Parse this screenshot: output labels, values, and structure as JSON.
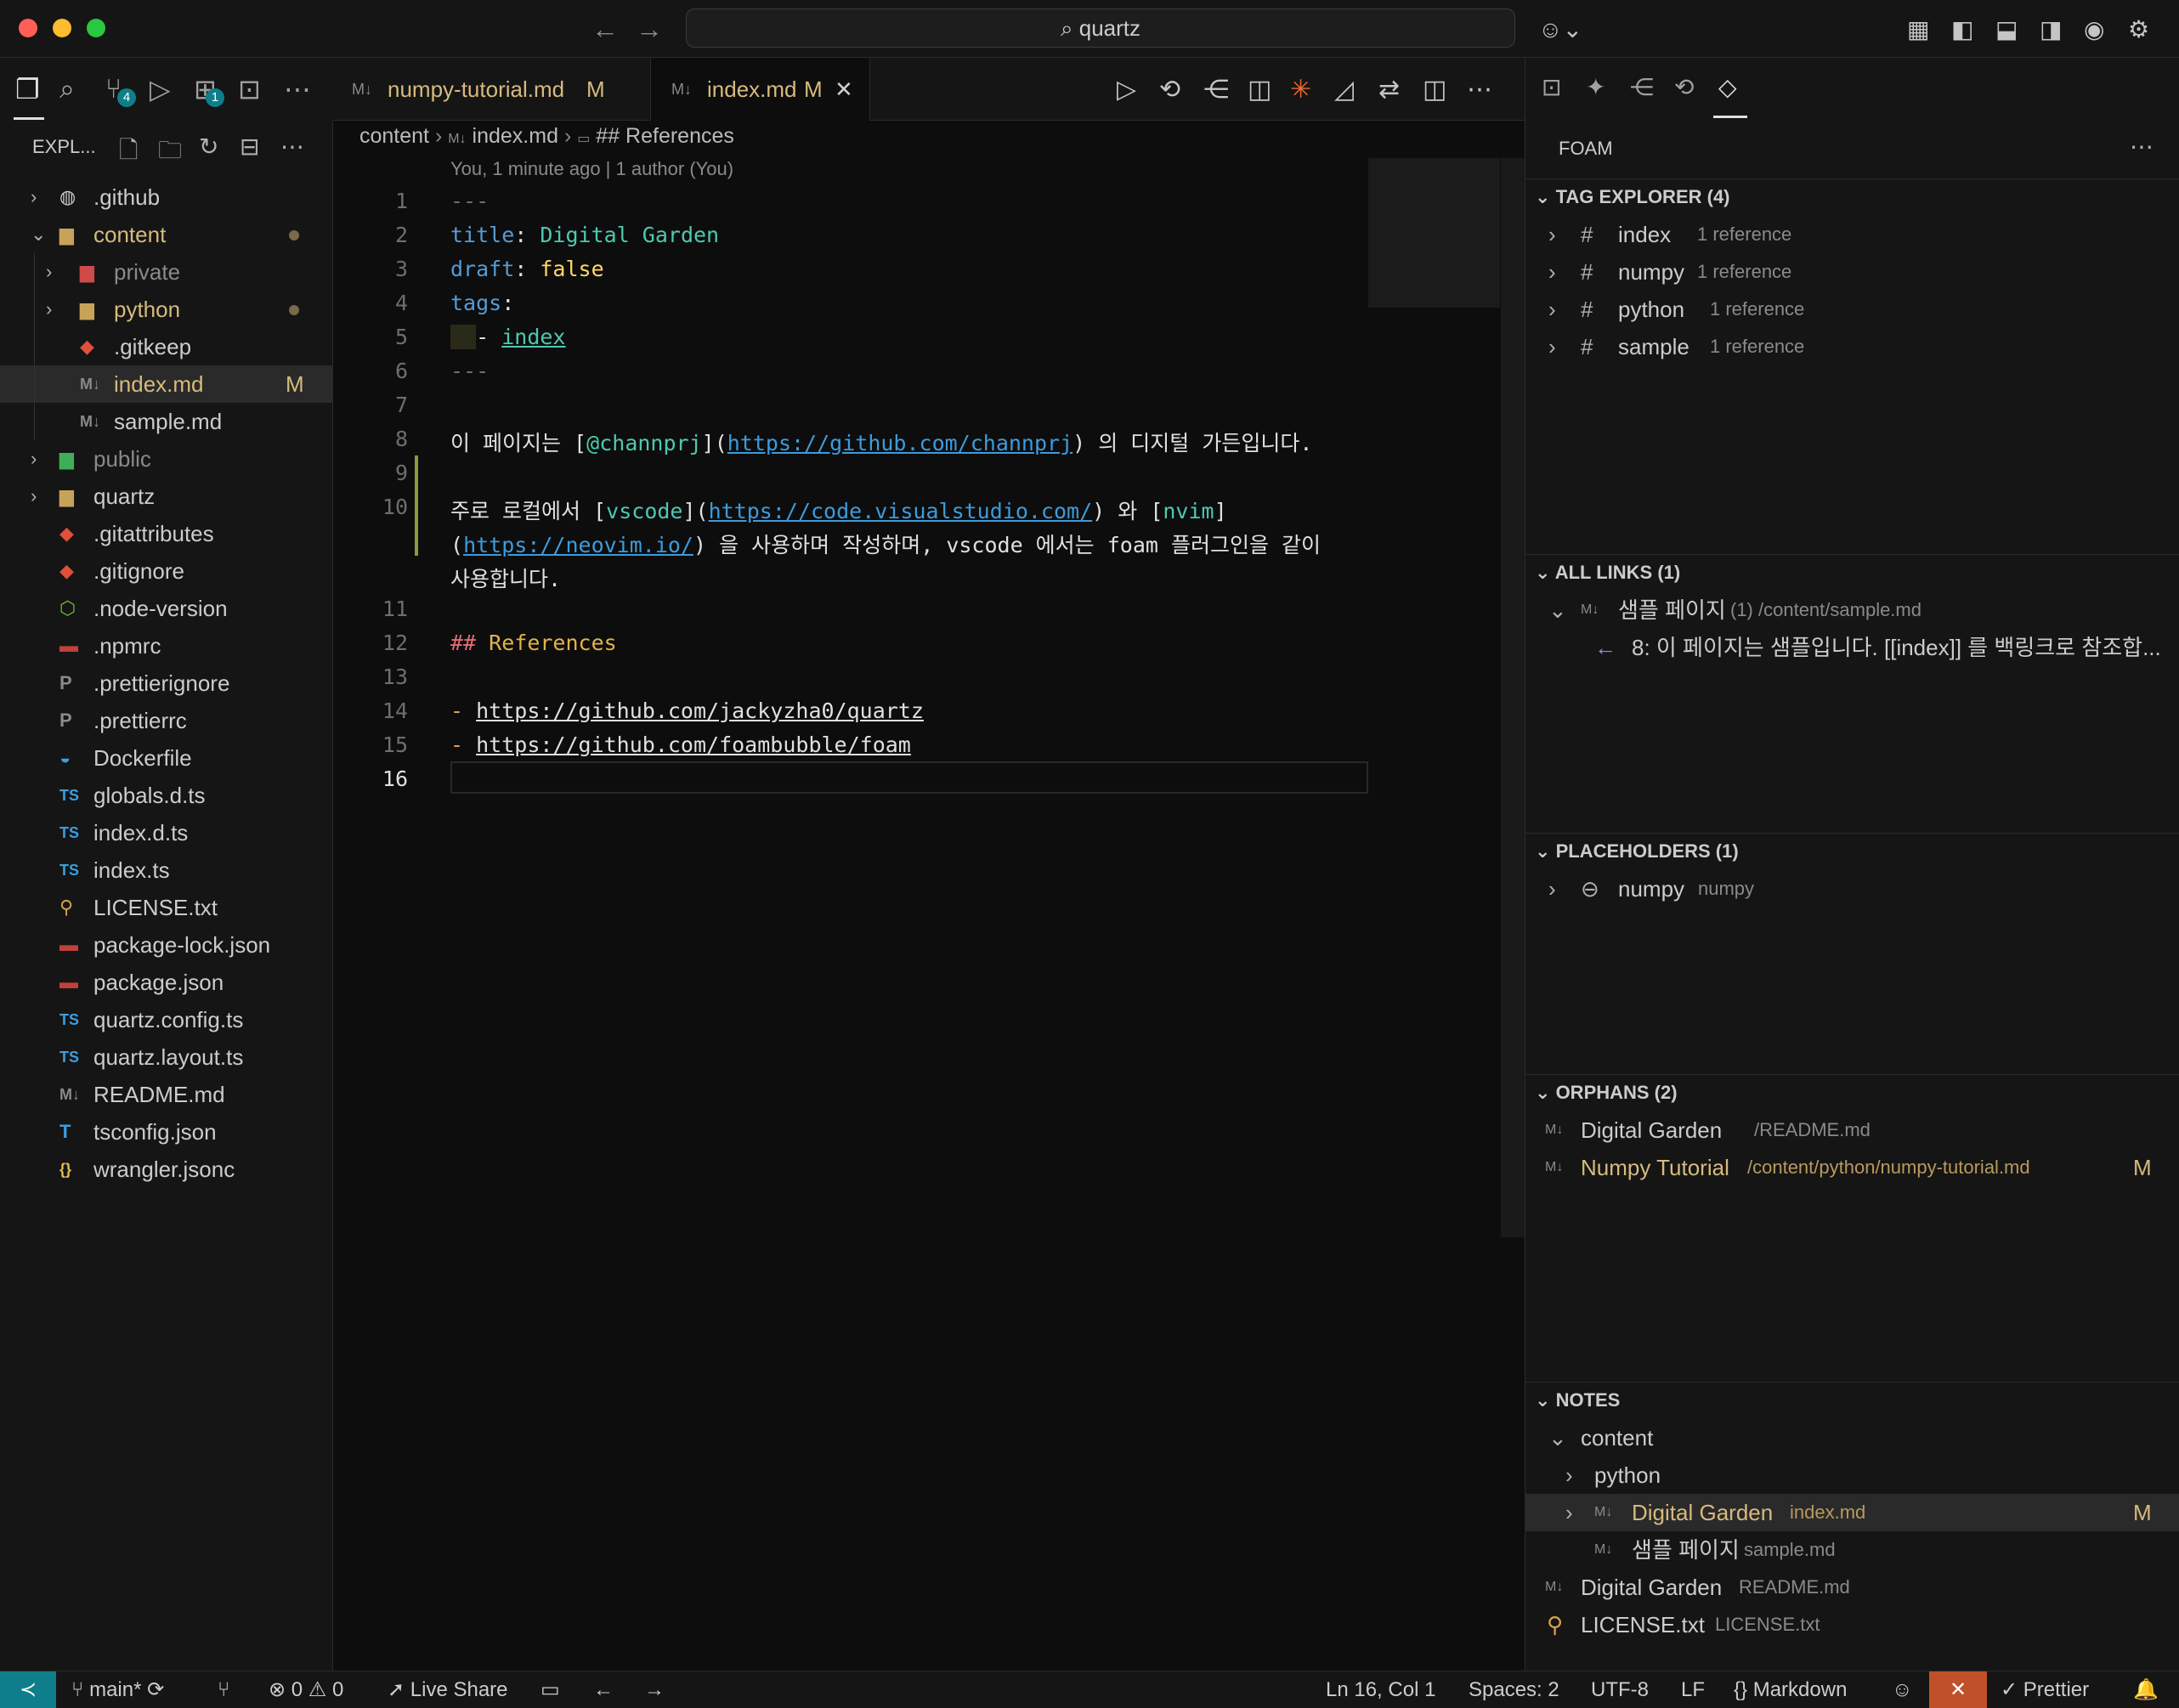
{
  "window": {
    "search": "quartz"
  },
  "tabs": [
    {
      "label": "numpy-tutorial.md",
      "flag": "M"
    },
    {
      "label": "index.md",
      "flag": "M"
    }
  ],
  "explorer": {
    "title": "EXPL...",
    "items": [
      {
        "name": ".github",
        "icon": "github-folder",
        "color": "#cccccc"
      },
      {
        "name": "content",
        "icon": "folder",
        "color": "#d7ba7d"
      },
      {
        "name": "private",
        "icon": "folder-private",
        "color": "#8a8a8a"
      },
      {
        "name": "python",
        "icon": "folder-python",
        "color": "#d7ba7d"
      },
      {
        "name": ".gitkeep",
        "icon": "git",
        "color": "#cccccc"
      },
      {
        "name": "index.md",
        "icon": "markdown",
        "color": "#d7ba7d",
        "flag": "M"
      },
      {
        "name": "sample.md",
        "icon": "markdown",
        "color": "#cccccc"
      },
      {
        "name": "public",
        "icon": "folder-public",
        "color": "#8a8a8a"
      },
      {
        "name": "quartz",
        "icon": "folder",
        "color": "#cccccc"
      },
      {
        "name": ".gitattributes",
        "icon": "git",
        "color": "#cccccc"
      },
      {
        "name": ".gitignore",
        "icon": "git",
        "color": "#cccccc"
      },
      {
        "name": ".node-version",
        "icon": "node",
        "color": "#cccccc"
      },
      {
        "name": ".npmrc",
        "icon": "npm",
        "color": "#cccccc"
      },
      {
        "name": ".prettierignore",
        "icon": "prettier",
        "color": "#cccccc"
      },
      {
        "name": ".prettierrc",
        "icon": "prettier",
        "color": "#cccccc"
      },
      {
        "name": "Dockerfile",
        "icon": "docker",
        "color": "#cccccc"
      },
      {
        "name": "globals.d.ts",
        "icon": "ts",
        "color": "#cccccc"
      },
      {
        "name": "index.d.ts",
        "icon": "ts",
        "color": "#cccccc"
      },
      {
        "name": "index.ts",
        "icon": "ts",
        "color": "#cccccc"
      },
      {
        "name": "LICENSE.txt",
        "icon": "license",
        "color": "#cccccc"
      },
      {
        "name": "package-lock.json",
        "icon": "npm",
        "color": "#cccccc"
      },
      {
        "name": "package.json",
        "icon": "npm",
        "color": "#cccccc"
      },
      {
        "name": "quartz.config.ts",
        "icon": "ts",
        "color": "#cccccc"
      },
      {
        "name": "quartz.layout.ts",
        "icon": "ts",
        "color": "#cccccc"
      },
      {
        "name": "README.md",
        "icon": "markdown",
        "color": "#cccccc"
      },
      {
        "name": "tsconfig.json",
        "icon": "tsconfig",
        "color": "#cccccc"
      },
      {
        "name": "wrangler.jsonc",
        "icon": "json",
        "color": "#cccccc"
      }
    ]
  },
  "breadcrumb": {
    "folder": "content",
    "file": "index.md",
    "section": "## References"
  },
  "blame": "You, 1 minute ago | 1 author (You)",
  "code": {
    "l1": "---",
    "l2k": "title",
    "l2v": "Digital Garden",
    "l3k": "draft",
    "l3v": "false",
    "l4k": "tags",
    "l5v": "index",
    "l6": "---",
    "l8a": "이 페이지는 ",
    "l8b": "@channprj",
    "l8c": "https://github.com/channprj",
    "l8d": " 의 디지털 가든입니다.",
    "l10a": "주로 로컬에서 ",
    "l10b": "vscode",
    "l10c": "https://code.visualstudio.com/",
    "l10d": " 와 ",
    "l10e": "nvim",
    "l10f": "https://neovim.io/",
    "l10g": " 을 사용하며 작성하며, vscode 에서는 foam 플러그인을 같이 ",
    "l10h": "사용합니다.",
    "l12a": "##",
    "l12b": "References",
    "l14": "https://github.com/jackyzha0/quartz",
    "l15": "https://github.com/foambubble/foam"
  },
  "foam": {
    "title": "FOAM",
    "tag_header": "TAG EXPLORER (4)",
    "tags": [
      {
        "name": "index",
        "refs": "1 reference"
      },
      {
        "name": "numpy",
        "refs": "1 reference"
      },
      {
        "name": "python",
        "refs": "1 reference"
      },
      {
        "name": "sample",
        "refs": "1 reference"
      }
    ],
    "links_header": "ALL LINKS (1)",
    "link": {
      "name": "샘플 페이지",
      "detail": "(1) /content/sample.md",
      "ref": "8: 이 페이지는 샘플입니다. [[index]] 를 백링크로 참조합..."
    },
    "placeholders_header": "PLACEHOLDERS (1)",
    "placeholder": {
      "name": "numpy",
      "detail": "numpy"
    },
    "orphans_header": "ORPHANS (2)",
    "orphans": [
      {
        "name": "Digital Garden",
        "path": "/README.md"
      },
      {
        "name": "Numpy Tutorial",
        "path": "/content/python/numpy-tutorial.md",
        "flag": "M"
      }
    ],
    "notes_header": "NOTES",
    "notes": {
      "folder": "content",
      "sub": "python",
      "n1": "Digital Garden",
      "n1f": "index.md",
      "n1flag": "M",
      "n2": "샘플 페이지",
      "n2f": "sample.md",
      "n3": "Digital Garden",
      "n3f": "README.md",
      "n4": "LICENSE.txt",
      "n4f": "LICENSE.txt"
    }
  },
  "status": {
    "branch": "main*",
    "errors": "0",
    "warnings": "0",
    "liveshare": "Live Share",
    "position": "Ln 16, Col 1",
    "spaces": "Spaces: 2",
    "encoding": "UTF-8",
    "eol": "LF",
    "language": "Markdown",
    "prettier": "Prettier"
  },
  "colors": {
    "accent": "#d7ba7d",
    "remote": "#0e7f8a",
    "warn": "#c0502a"
  }
}
